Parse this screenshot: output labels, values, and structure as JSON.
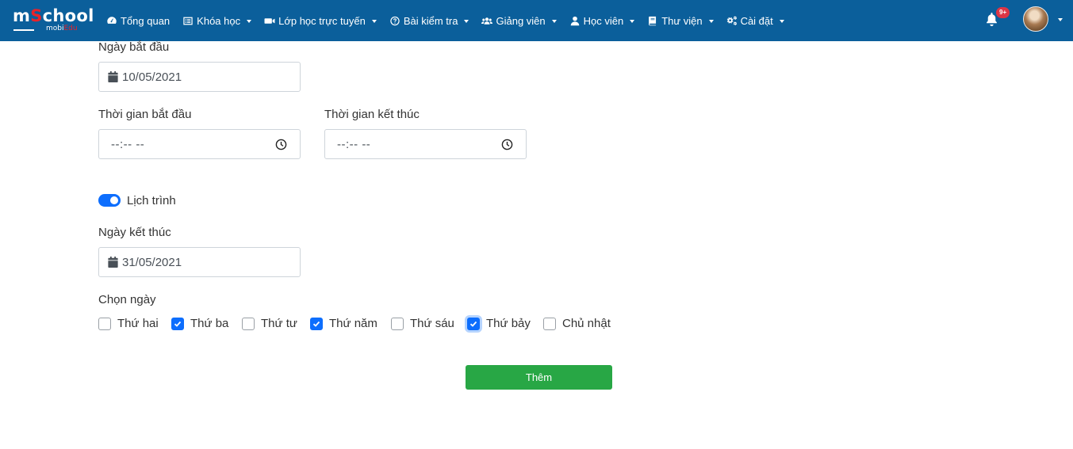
{
  "brand": {
    "logo_main_prefix": "m",
    "logo_main_accent": "S",
    "logo_main_suffix": "chool",
    "logo_sub_prefix": "mobi",
    "logo_sub_accent": "Edu",
    "color_primary": "#0b5f9b",
    "color_accent": "#e8232a"
  },
  "nav": {
    "items": [
      {
        "label": "Tổng quan",
        "icon": "dashboard-icon",
        "has_caret": false
      },
      {
        "label": "Khóa học",
        "icon": "list-icon",
        "has_caret": true
      },
      {
        "label": "Lớp học trực tuyến",
        "icon": "video-camera-icon",
        "has_caret": true
      },
      {
        "label": "Bài kiểm tra",
        "icon": "question-circle-icon",
        "has_caret": true
      },
      {
        "label": "Giảng viên",
        "icon": "users-icon",
        "has_caret": true
      },
      {
        "label": "Học viên",
        "icon": "user-icon",
        "has_caret": true
      },
      {
        "label": "Thư viện",
        "icon": "book-icon",
        "has_caret": true
      },
      {
        "label": "Cài đặt",
        "icon": "cogs-icon",
        "has_caret": true
      }
    ],
    "notification_badge": "9+"
  },
  "form": {
    "start_date_label": "Ngày bắt đầu",
    "start_date_value": "10/05/2021",
    "start_time_label": "Thời gian bắt đầu",
    "start_time_placeholder": "--:-- --",
    "end_time_label": "Thời gian kết thúc",
    "end_time_placeholder": "--:-- --",
    "schedule_label": "Lịch trình",
    "schedule_enabled": true,
    "end_date_label": "Ngày kết thúc",
    "end_date_value": "31/05/2021",
    "days_label": "Chọn ngày",
    "days": [
      {
        "label": "Thứ hai",
        "checked": false
      },
      {
        "label": "Thứ ba",
        "checked": true
      },
      {
        "label": "Thứ tư",
        "checked": false
      },
      {
        "label": "Thứ năm",
        "checked": true
      },
      {
        "label": "Thứ sáu",
        "checked": false
      },
      {
        "label": "Thứ bảy",
        "checked": true
      },
      {
        "label": "Chủ nhật",
        "checked": false
      }
    ],
    "submit_label": "Thêm",
    "submit_color": "#28a745",
    "toggle_color": "#0d6efd"
  }
}
